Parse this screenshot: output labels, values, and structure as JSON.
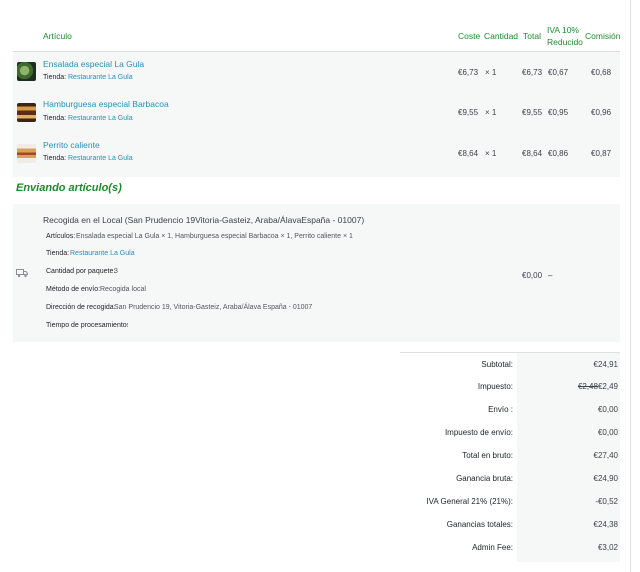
{
  "table": {
    "headers": {
      "item": "Artículo",
      "cost": "Coste",
      "qty": "Cantidad",
      "total": "Total",
      "iva_line1": "IVA 10%",
      "iva_line2": "Reducido",
      "commission": "Comisión"
    },
    "items": [
      {
        "name": "Ensalada especial La Gula",
        "store_label": "Tienda:",
        "store": "Restaurante La Gula",
        "cost": "€6,73",
        "qty": "× 1",
        "total": "€6,73",
        "iva": "€0,67",
        "commission": "€0,68",
        "thumb": "salad-thumbnail"
      },
      {
        "name": "Hamburguesa especial Barbacoa",
        "store_label": "Tienda:",
        "store": "Restaurante La Gula",
        "cost": "€9,55",
        "qty": "× 1",
        "total": "€9,55",
        "iva": "€0,95",
        "commission": "€0,96",
        "thumb": "burger-thumbnail"
      },
      {
        "name": "Perrito caliente",
        "store_label": "Tienda:",
        "store": "Restaurante La Gula",
        "cost": "€8,64",
        "qty": "× 1",
        "total": "€8,64",
        "iva": "€0,86",
        "commission": "€0,87",
        "thumb": "hotdog-thumbnail"
      }
    ]
  },
  "shipping": {
    "heading": "Enviando artículo(s)",
    "icon": "truck-icon",
    "method_title": "Recogida en el Local (San Prudencio 19Vitoria-Gasteiz, Araba/ÁlavaEspaña - 01007)",
    "items_label": "Artículos:",
    "items_value": "Ensalada especial La Gula × 1, Hamburguesa especial Barbacoa × 1, Perrito caliente × 1",
    "store_label": "Tienda:",
    "store_value": "Restaurante La Gula",
    "qty_label": "Cantidad por paquete:",
    "qty_value": "3",
    "method_label": "Método de envío:",
    "method_value": "Recogida local",
    "address_label": "Dirección de recogida:",
    "address_value": "San Prudencio 19, Vitoria-Gasteiz, Araba/Álava España - 01007",
    "time_label": "Tiempo de procesamiento:",
    "time_value": "-",
    "total": "€0,00",
    "tax": "–"
  },
  "totals": [
    {
      "label": "Subtotal:",
      "value": "€24,91"
    },
    {
      "label": "Impuesto:",
      "old": "€2,48",
      "value": "€2,49"
    },
    {
      "label": "Envío :",
      "value": "€0,00"
    },
    {
      "label": "Impuesto de envío:",
      "value": "€0,00"
    },
    {
      "label": "Total en bruto:",
      "value": "€27,40"
    },
    {
      "label": "Ganancia bruta:",
      "value": "€24,90"
    },
    {
      "label": "IVA General 21% (21%):",
      "value": "-€0,52"
    },
    {
      "label": "Ganancias totales:",
      "value": "€24,38"
    },
    {
      "label": "Admin Fee:",
      "value": "€3,02"
    }
  ],
  "colors": {
    "accent": "#1e8a2e",
    "link": "#2a8fb8",
    "row_bg": "#f6f7f7"
  }
}
